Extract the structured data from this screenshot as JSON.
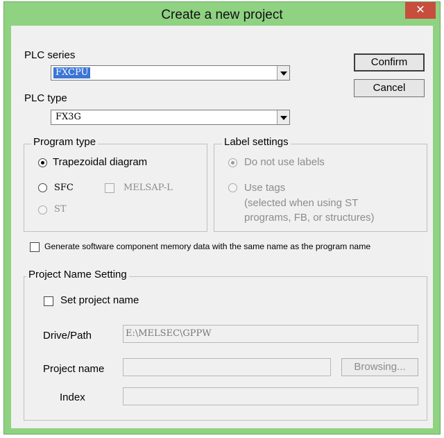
{
  "dialog": {
    "title": "Create a new project",
    "close_glyph": "✕"
  },
  "plc_series": {
    "label": "PLC series",
    "value": "FXCPU"
  },
  "plc_type": {
    "label": "PLC type",
    "value": "FX3G"
  },
  "buttons": {
    "confirm": "Confirm",
    "cancel": "Cancel",
    "browse": "Browsing..."
  },
  "program_type": {
    "legend": "Program type",
    "trapezoidal": "Trapezoidal diagram",
    "sfc": "SFC",
    "melsap": "MELSAP-L",
    "st": "ST"
  },
  "label_settings": {
    "legend": "Label settings",
    "no_labels": "Do not use labels",
    "use_tags": "Use tags",
    "note_line1": "(selected when using ST",
    "note_line2": "programs, FB, or structures)"
  },
  "generate_checkbox": "Generate software component memory data with the same name as the program name",
  "project_name": {
    "legend": "Project Name Setting",
    "set_label": "Set project name",
    "drive_path_label": "Drive/Path",
    "drive_path_value": "E:\\MELSEC\\GPPW",
    "name_label": "Project name",
    "name_value": "",
    "index_label": "Index",
    "index_value": ""
  },
  "colors": {
    "title_bar": "#8fd282",
    "close_button": "#c74e3e",
    "selection": "#3b75d6"
  }
}
